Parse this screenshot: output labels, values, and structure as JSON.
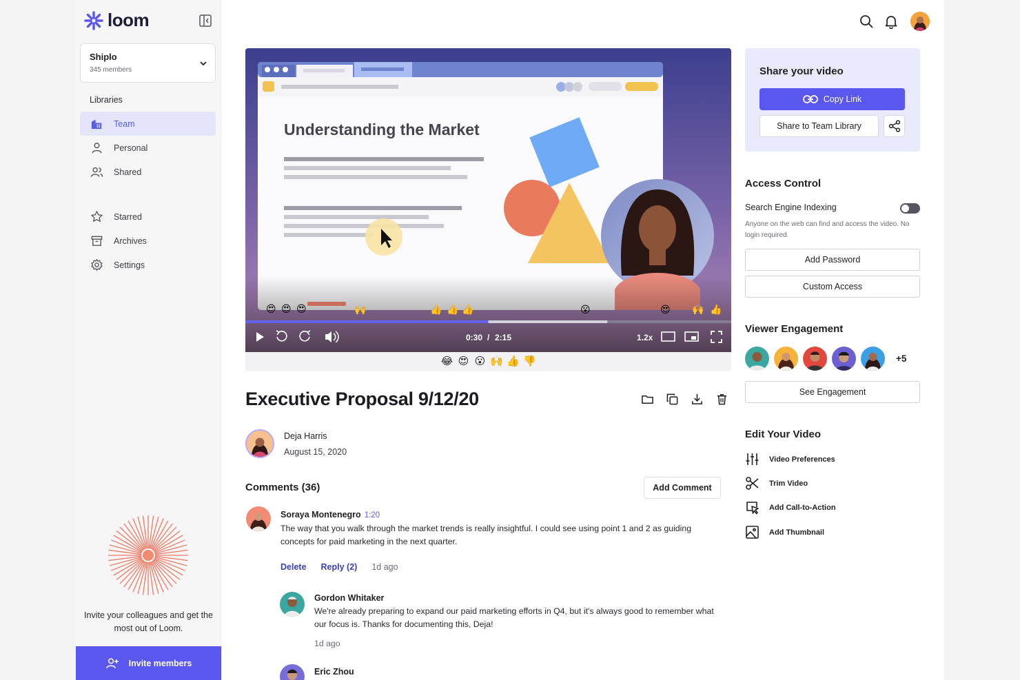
{
  "brand": {
    "name": "loom",
    "accent": "#5a57ee"
  },
  "workspace": {
    "name": "Shiplo",
    "members": "345 members"
  },
  "sidebar": {
    "libraries_title": "Libraries",
    "items": [
      {
        "label": "Team",
        "icon": "building-icon",
        "active": true
      },
      {
        "label": "Personal",
        "icon": "person-icon"
      },
      {
        "label": "Shared",
        "icon": "people-icon"
      },
      {
        "label": "Starred",
        "icon": "star-icon"
      },
      {
        "label": "Archives",
        "icon": "archive-icon"
      },
      {
        "label": "Settings",
        "icon": "gear-icon"
      }
    ],
    "invite_text": "Invite your colleagues and get the most out of Loom.",
    "invite_button": "Invite members"
  },
  "video": {
    "slide_title": "Understanding the Market",
    "current_time": "0:30",
    "separator": "/",
    "duration": "2:15",
    "speed": "1.2x",
    "progress": 0.5,
    "buffered": 0.745
  },
  "reactions": [
    "😂",
    "😍",
    "😮",
    "🙌",
    "👍",
    "👎"
  ],
  "main": {
    "title": "Executive Proposal 9/12/20",
    "author": "Deja Harris",
    "date": "August 15, 2020",
    "comments_title": "Comments (36)",
    "add_comment": "Add Comment"
  },
  "comments": [
    {
      "name": "Soraya Montenegro",
      "time": "1:20",
      "text": "The way that you walk through the market trends is really insightful. I could see using point 1 and 2 as guiding concepts for paid marketing in the next quarter.",
      "delete": "Delete",
      "reply": "Reply (2)",
      "ago": "1d ago"
    },
    {
      "name": "Gordon Whitaker",
      "text": "We're already preparing to expand our paid marketing efforts in Q4, but it's always good to remember what our focus is. Thanks for documenting this, Deja!",
      "ago": "1d ago"
    },
    {
      "name": "Eric Zhou"
    }
  ],
  "share": {
    "title": "Share your video",
    "copy_link": "Copy Link",
    "share_team": "Share to Team Library"
  },
  "access": {
    "title": "Access Control",
    "indexing_label": "Search Engine Indexing",
    "indexing_desc": "Anyone on the web can find and access the video. No login required.",
    "add_password": "Add Password",
    "custom_access": "Custom Access"
  },
  "engagement": {
    "title": "Viewer Engagement",
    "more": "+5",
    "see": "See Engagement"
  },
  "edit": {
    "title": "Edit Your Video",
    "items": [
      {
        "label": "Video Preferences",
        "icon": "sliders-icon"
      },
      {
        "label": "Trim Video",
        "icon": "scissors-icon"
      },
      {
        "label": "Add Call-to-Action",
        "icon": "cursor-click-icon"
      },
      {
        "label": "Add Thumbnail",
        "icon": "image-icon"
      }
    ]
  }
}
